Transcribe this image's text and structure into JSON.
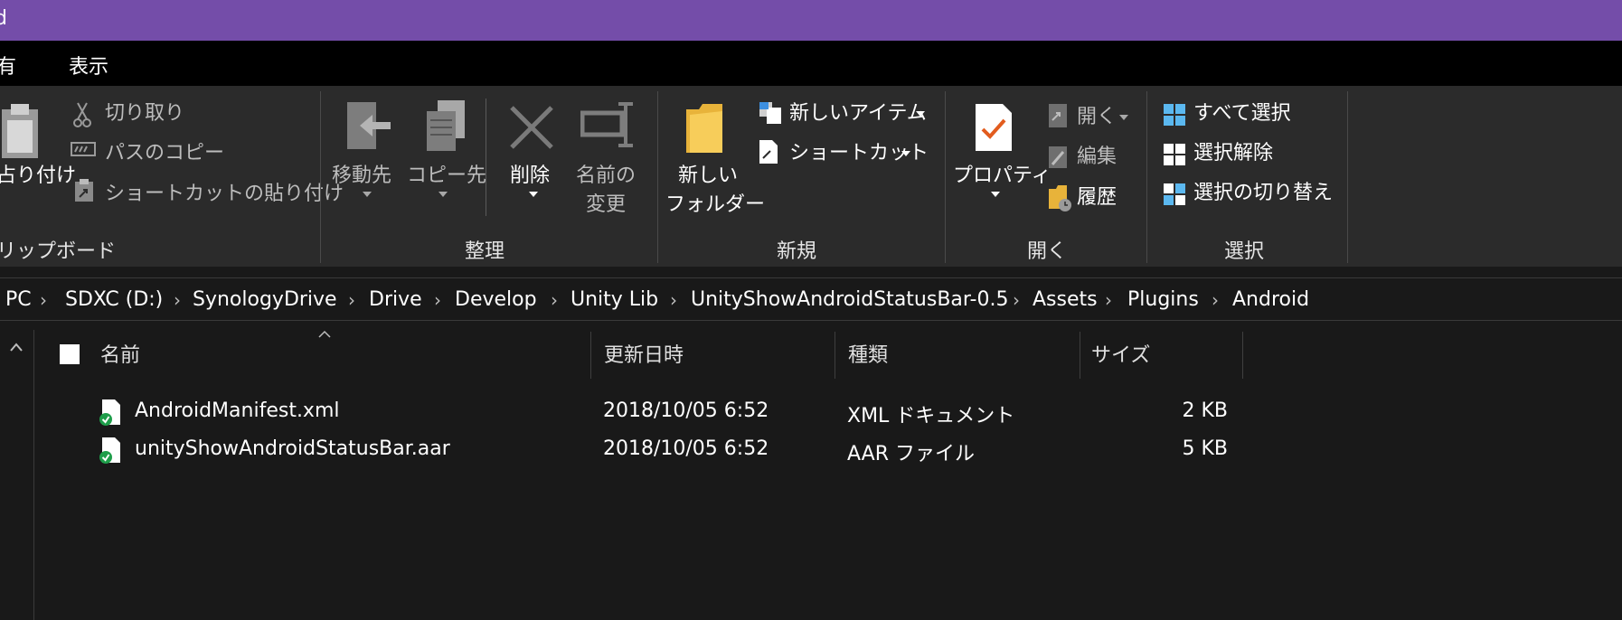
{
  "window": {
    "title_fragment": "d"
  },
  "menu": {
    "share_fragment": "有",
    "view": "表示"
  },
  "ribbon": {
    "clipboard": {
      "paste_fragment": "占り付け",
      "cut": "切り取り",
      "copy_path": "パスのコピー",
      "paste_shortcut": "ショートカットの貼り付け",
      "group_label_fragment": "リップボード"
    },
    "organize": {
      "move_to": "移動先",
      "copy_to": "コピー先",
      "delete": "削除",
      "rename_line1": "名前の",
      "rename_line2": "変更",
      "group_label": "整理"
    },
    "new": {
      "new_folder_line1": "新しい",
      "new_folder_line2": "フォルダー",
      "new_item": "新しいアイテム",
      "easy_access": "ショートカット",
      "group_label": "新規"
    },
    "open": {
      "properties": "プロパティ",
      "open": "開く",
      "edit": "編集",
      "history": "履歴",
      "group_label": "開く"
    },
    "select": {
      "select_all": "すべて選択",
      "select_none": "選択解除",
      "invert_selection": "選択の切り替え",
      "group_label": "選択"
    }
  },
  "address": {
    "crumbs": [
      "PC",
      "SDXC (D:)",
      "SynologyDrive",
      "Drive",
      "Develop",
      "Unity Lib",
      "UnityShowAndroidStatusBar-0.5",
      "Assets",
      "Plugins",
      "Android"
    ]
  },
  "file_list": {
    "columns": {
      "name": "名前",
      "date": "更新日時",
      "type": "種類",
      "size": "サイズ"
    },
    "rows": [
      {
        "name": "AndroidManifest.xml",
        "date": "2018/10/05 6:52",
        "type": "XML ドキュメント",
        "size": "2 KB"
      },
      {
        "name": "unityShowAndroidStatusBar.aar",
        "date": "2018/10/05 6:52",
        "type": "AAR ファイル",
        "size": "5 KB"
      }
    ]
  },
  "colors": {
    "title_bar": "#744da9",
    "background": "#191919",
    "ribbon": "#2b2b2b",
    "sync_ok": "#1e9e4a"
  }
}
